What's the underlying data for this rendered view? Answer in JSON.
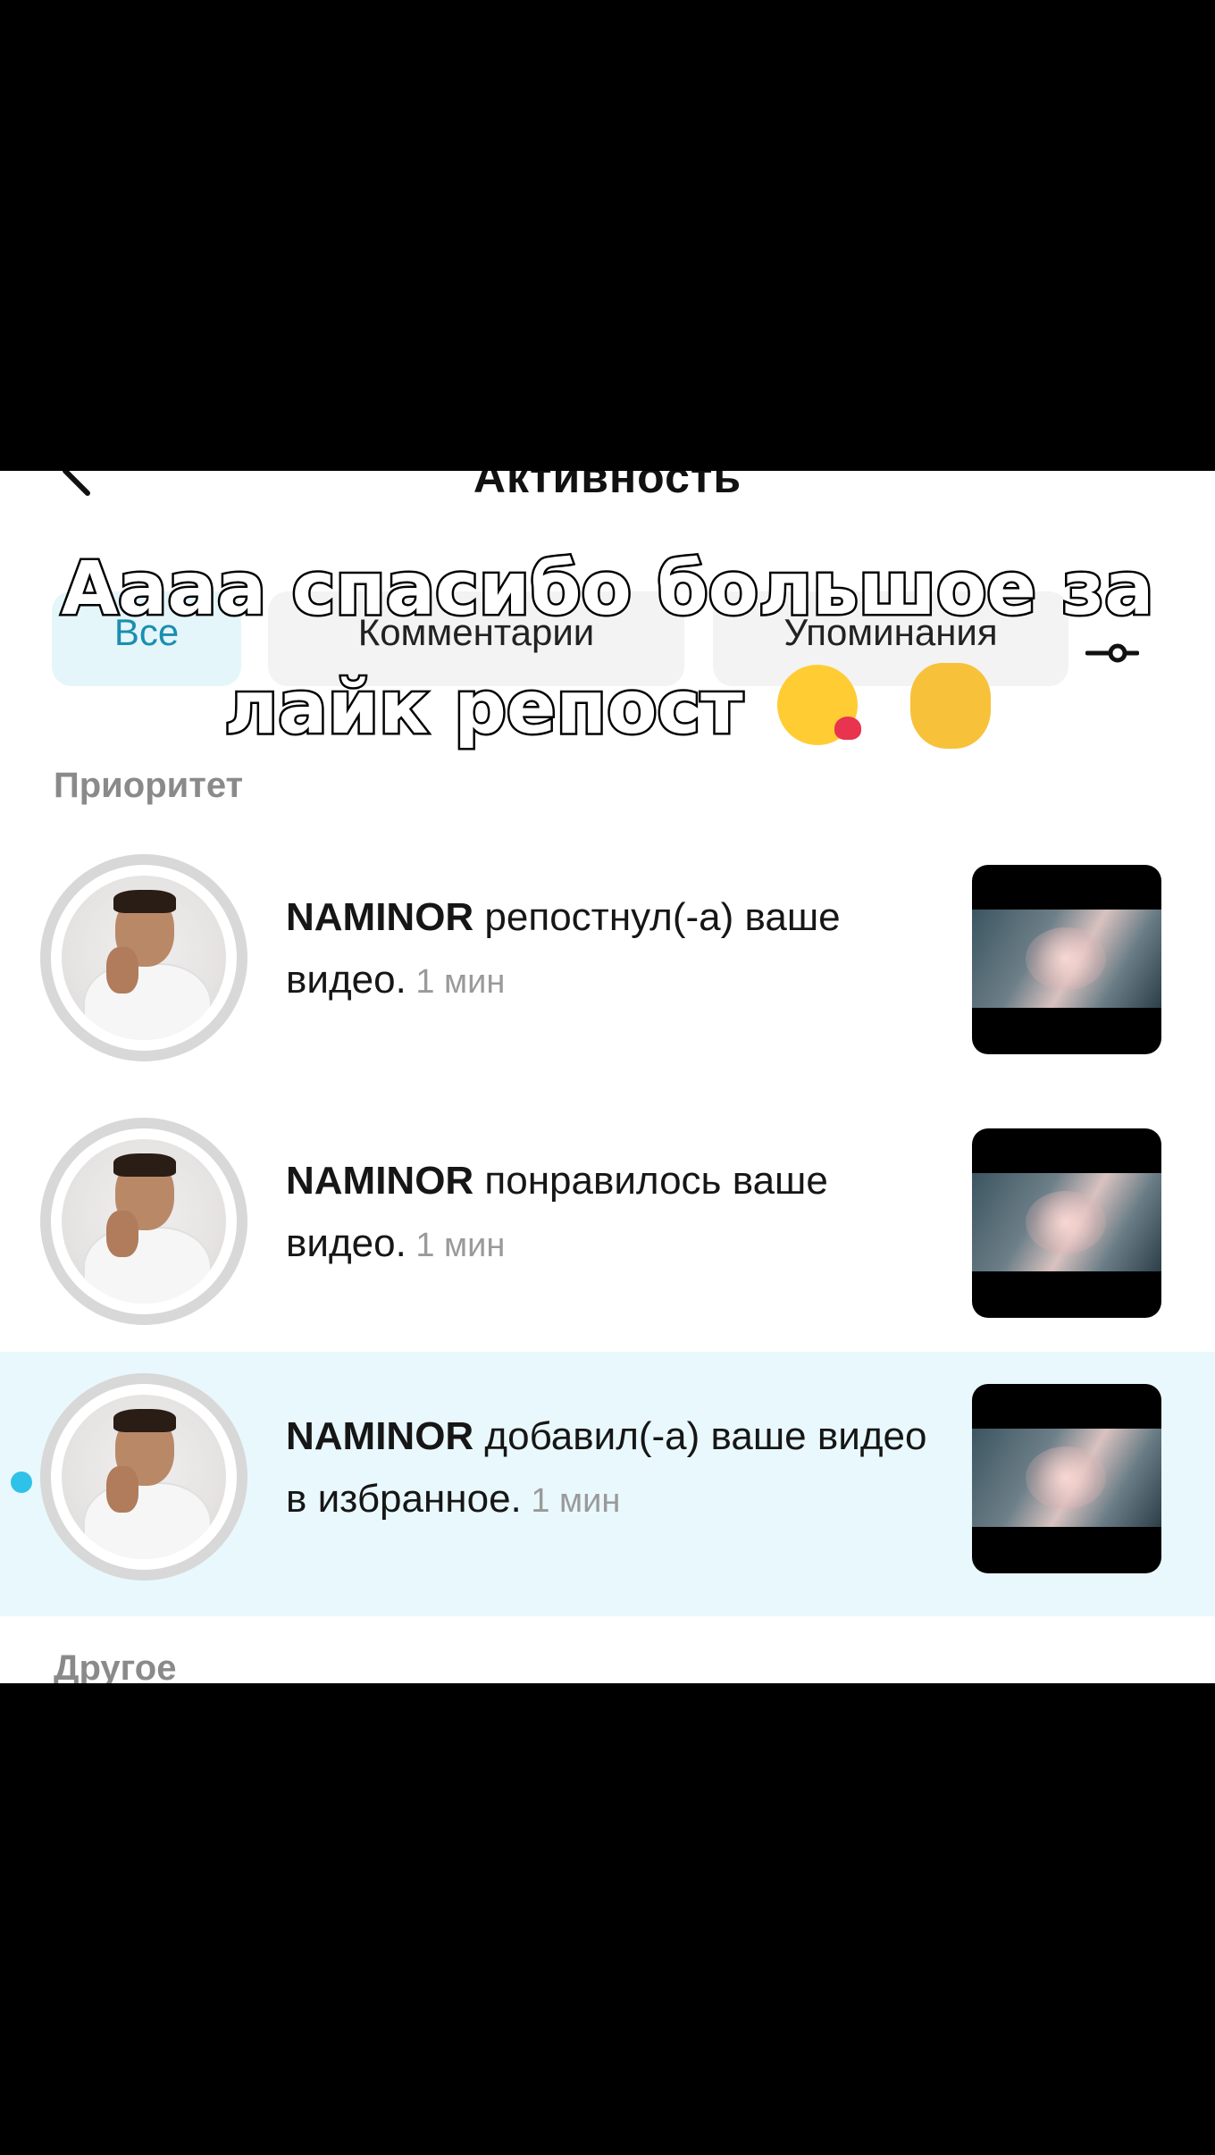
{
  "header": {
    "title": "Активность"
  },
  "tabs": [
    {
      "label": "Все",
      "active": true
    },
    {
      "label": "Комментарии",
      "active": false
    },
    {
      "label": "Упоминания",
      "active": false
    }
  ],
  "sections": {
    "priority": "Приоритет",
    "other": "Другое"
  },
  "caption": {
    "line1": "Аааа спасибо большое за",
    "line2": "лайк репост"
  },
  "notifications": [
    {
      "user": "NAMINOR",
      "text": " репостнул(-а) ваше видео.",
      "time": " 1 мин",
      "unread": false
    },
    {
      "user": "NAMINOR",
      "text": " понравилось ваше видео.",
      "time": " 1 мин",
      "unread": false
    },
    {
      "user": "NAMINOR",
      "text": " добавил(-а) ваше видео в избранное.",
      "time": " 1 мин",
      "unread": true
    }
  ],
  "colors": {
    "unread_dot": "#2ec2e8",
    "unread_bg": "#e9f8fc",
    "active_tab_text": "#1a8fb0"
  }
}
